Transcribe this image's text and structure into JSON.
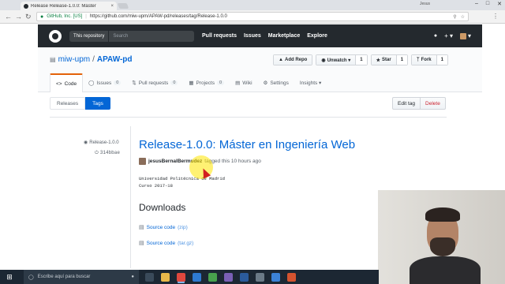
{
  "browser": {
    "tab_title": "Release Release-1.0.0: Máster",
    "tab_close": "×",
    "user_label": "Jesus",
    "minimize": "–",
    "maximize": "□",
    "close": "✕",
    "back": "←",
    "forward": "→",
    "reload": "↻",
    "secure_label": "GitHub, Inc. [US]",
    "url": "https://github.com/miw-upm/APAW-pd/releases/tag/Release-1.0.0",
    "menu": "⋮"
  },
  "github": {
    "search_scope": "This repository",
    "search_placeholder": "Search",
    "nav": [
      "Pull requests",
      "Issues",
      "Marketplace",
      "Explore"
    ],
    "bell": "🔔",
    "plus": "+ ▾",
    "avatar_caret": "▾"
  },
  "repo": {
    "owner": "miw-upm",
    "slash": "/",
    "name": "APAW-pd",
    "book_icon": "▤",
    "add_repo": "Add Repo",
    "unwatch": "Unwatch ▾",
    "unwatch_count": "1",
    "star": "Star",
    "star_count": "1",
    "fork": "Fork",
    "fork_count": "1",
    "tabs": [
      {
        "label": "Code",
        "count": ""
      },
      {
        "label": "Issues",
        "count": "0"
      },
      {
        "label": "Pull requests",
        "count": "0"
      },
      {
        "label": "Projects",
        "count": "0"
      },
      {
        "label": "Wiki",
        "count": ""
      },
      {
        "label": "Settings",
        "count": ""
      },
      {
        "label": "Insights ▾",
        "count": ""
      }
    ]
  },
  "subnav": {
    "releases": "Releases",
    "tags": "Tags"
  },
  "actions": {
    "edit": "Edit tag",
    "delete": "Delete"
  },
  "release": {
    "tag": "Release-1.0.0",
    "commit": "314bbae",
    "title": "Release-1.0.0: Máster en Ingeniería Web",
    "author": "jesusBernalBermudez",
    "tagged_text": "tagged this 10 hours ago",
    "notes_line1": "Universidad Politécnica de Madrid",
    "notes_line2": "Curso 2017-18",
    "downloads_heading": "Downloads",
    "downloads": [
      {
        "label": "Source code",
        "ext": "(zip)"
      },
      {
        "label": "Source code",
        "ext": "(tar.gz)"
      }
    ]
  },
  "taskbar": {
    "start": "⊞",
    "search_placeholder": "Escribe aquí para buscar",
    "mic": "🎤"
  },
  "colors": {
    "github_header": "#24292e",
    "link": "#0366d6",
    "tab_accent": "#e36209",
    "danger": "#cb2431",
    "taskbar": "#1c2733"
  }
}
